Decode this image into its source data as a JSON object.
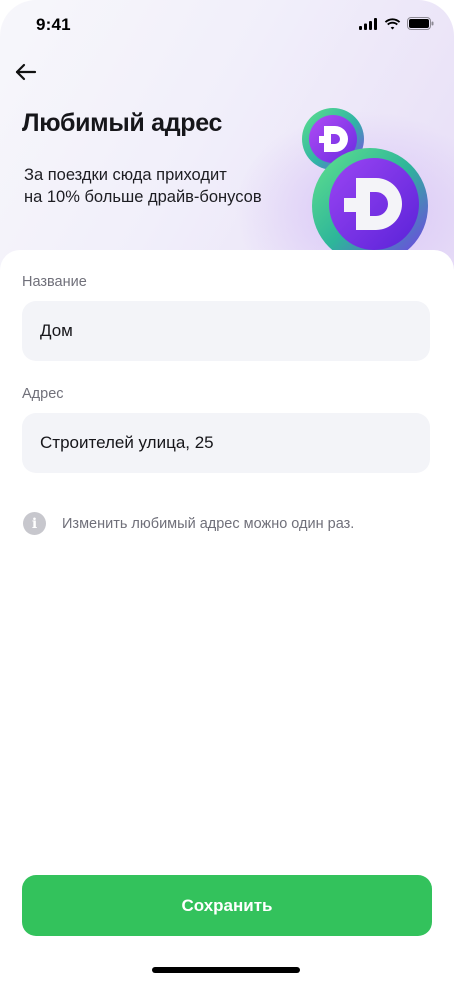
{
  "status_bar": {
    "time": "9:41",
    "icons": [
      "cellular-signal-icon",
      "wifi-icon",
      "battery-icon"
    ]
  },
  "header": {
    "back_icon": "arrow-left-icon",
    "title": "Любимый адрес",
    "subtitle_line1": "За поездки сюда приходит",
    "subtitle_line2": "на 10% больше драйв-бонусов",
    "illustration": "drive-bonus-coins"
  },
  "form": {
    "name_label": "Название",
    "name_value": "Дом",
    "address_label": "Адрес",
    "address_value": "Строителей улица, 25"
  },
  "info": {
    "icon": "info-icon",
    "text": "Изменить любимый адрес можно один раз."
  },
  "footer": {
    "save_label": "Сохранить"
  },
  "colors": {
    "accent_green": "#33c25c",
    "field_background": "#f3f4f8",
    "label_gray": "#70707a",
    "hero_tint": "#e7ddf7"
  }
}
